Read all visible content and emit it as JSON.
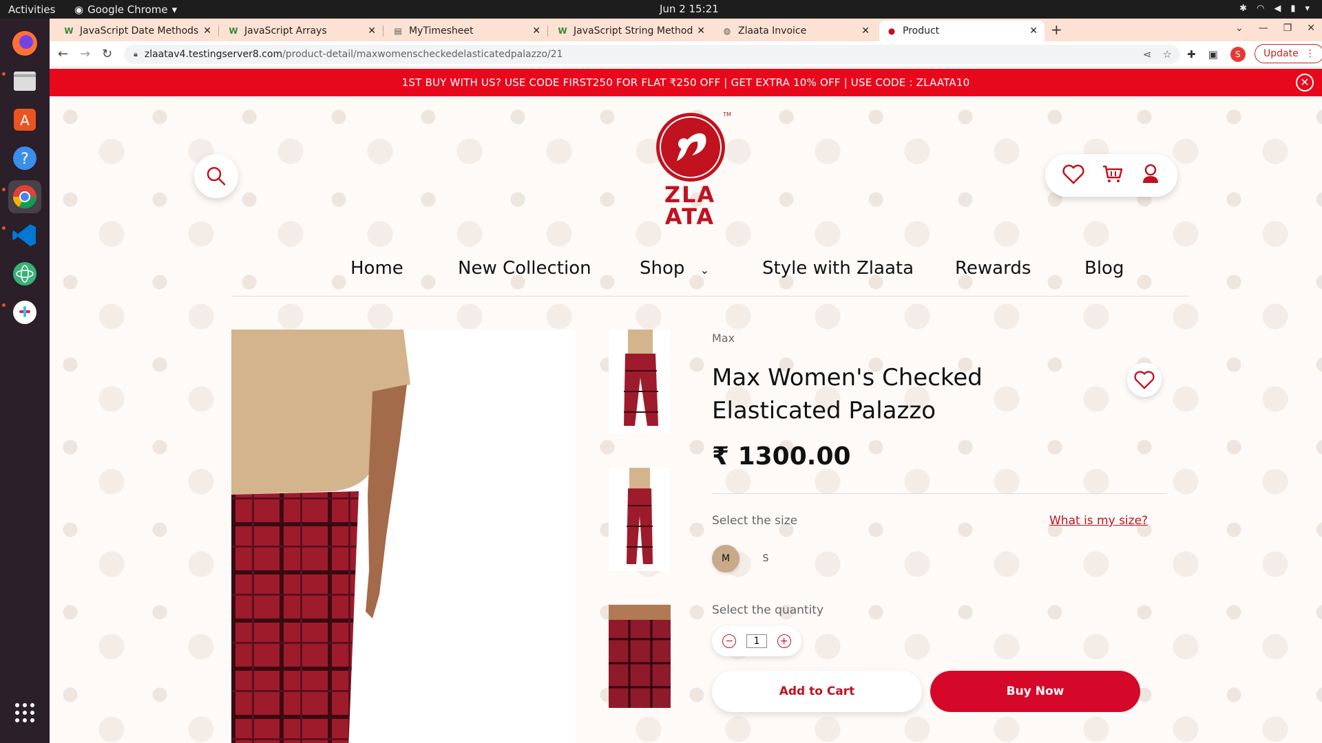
{
  "os": {
    "activities": "Activities",
    "app_name": "Google Chrome",
    "clock": "Jun 2  15:21"
  },
  "browser": {
    "tabs": [
      {
        "title": "JavaScript Date Methods",
        "favicon": "w-icon"
      },
      {
        "title": "JavaScript Arrays",
        "favicon": "w-icon"
      },
      {
        "title": "MyTimesheet",
        "favicon": "timesheet-icon"
      },
      {
        "title": "JavaScript String Method",
        "favicon": "w-icon"
      },
      {
        "title": "Zlaata Invoice",
        "favicon": "globe-icon"
      },
      {
        "title": "Product",
        "favicon": "zlaata-icon"
      }
    ],
    "url_host": "zlaatav4.testingserver8.com",
    "url_path": "/product-detail/maxwomenscheckedelasticatedpalazzo/21",
    "profile_initial": "S",
    "update_label": "Update"
  },
  "promo": {
    "text": "1ST BUY WITH US? USE CODE FIRST250 FOR FLAT ₹250 OFF | GET EXTRA 10% OFF | USE CODE : ZLAATA10"
  },
  "site": {
    "logo_line1": "ZLA",
    "logo_line2": "ATA",
    "logo_tm": "TM",
    "nav": [
      {
        "label": "Home"
      },
      {
        "label": "New Collection"
      },
      {
        "label": "Shop"
      },
      {
        "label": "Style with Zlaata"
      },
      {
        "label": "Rewards"
      },
      {
        "label": "Blog"
      }
    ]
  },
  "product": {
    "brand": "Max",
    "title": "Max Women's Checked Elasticated Palazzo",
    "price": "₹ 1300.00",
    "size_label": "Select the size",
    "size_link": "What is my size?",
    "sizes": [
      "M",
      "S"
    ],
    "selected_size": "M",
    "qty_label": "Select the quantity",
    "quantity": "1",
    "add_to_cart": "Add to Cart",
    "buy_now": "Buy Now"
  },
  "colors": {
    "brand_red": "#c1121f",
    "promo_red": "#e8081c",
    "buy_button": "#d6082a",
    "tab_strip": "#fde1d3",
    "selected_size_bg": "#c9a98a"
  }
}
